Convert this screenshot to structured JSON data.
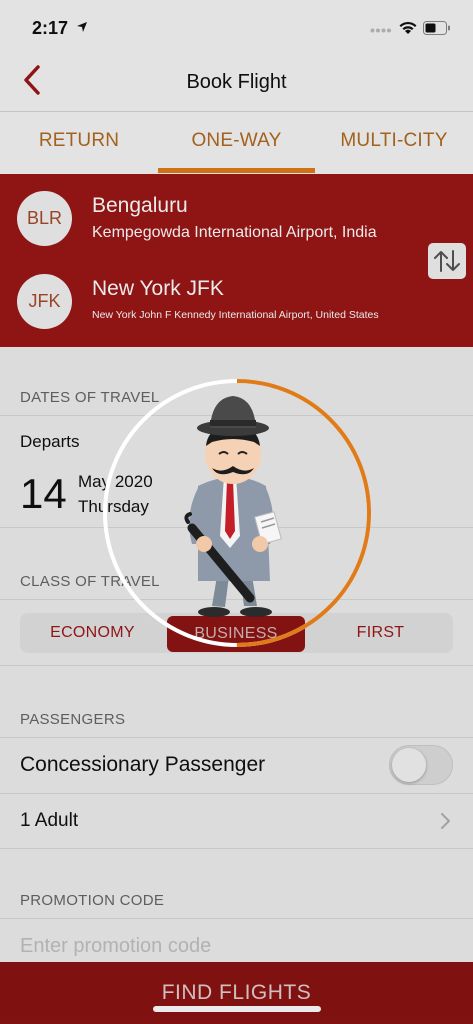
{
  "status": {
    "time": "2:17"
  },
  "nav": {
    "title": "Book Flight"
  },
  "tabs": [
    {
      "label": "RETURN"
    },
    {
      "label": "ONE-WAY"
    },
    {
      "label": "MULTI-CITY"
    }
  ],
  "route": {
    "origin": {
      "code": "BLR",
      "city": "Bengaluru",
      "airport": "Kempegowda International Airport, India"
    },
    "destination": {
      "code": "JFK",
      "city": "New York JFK",
      "airport": "New York John F Kennedy International Airport, United States"
    }
  },
  "dates": {
    "section": "DATES OF TRAVEL",
    "departs_label": "Departs",
    "day": "14",
    "month_year": "May 2020",
    "weekday": "Thursday"
  },
  "class": {
    "section": "CLASS OF TRAVEL",
    "options": [
      "ECONOMY",
      "BUSINESS",
      "FIRST"
    ],
    "selected": "BUSINESS"
  },
  "passengers": {
    "section": "PASSENGERS",
    "concession_label": "Concessionary Passenger",
    "concession_on": false,
    "count_label": "1 Adult"
  },
  "promo": {
    "section": "PROMOTION CODE",
    "placeholder": "Enter promotion code",
    "value": ""
  },
  "action": {
    "find_label": "FIND FLIGHTS"
  },
  "loader": {
    "progress": 0.5
  },
  "colors": {
    "brand_red": "#9c1717",
    "tab_text": "#b06a1f",
    "tab_indicator": "#e07b1a",
    "loader_arc": "#e07b1a"
  }
}
